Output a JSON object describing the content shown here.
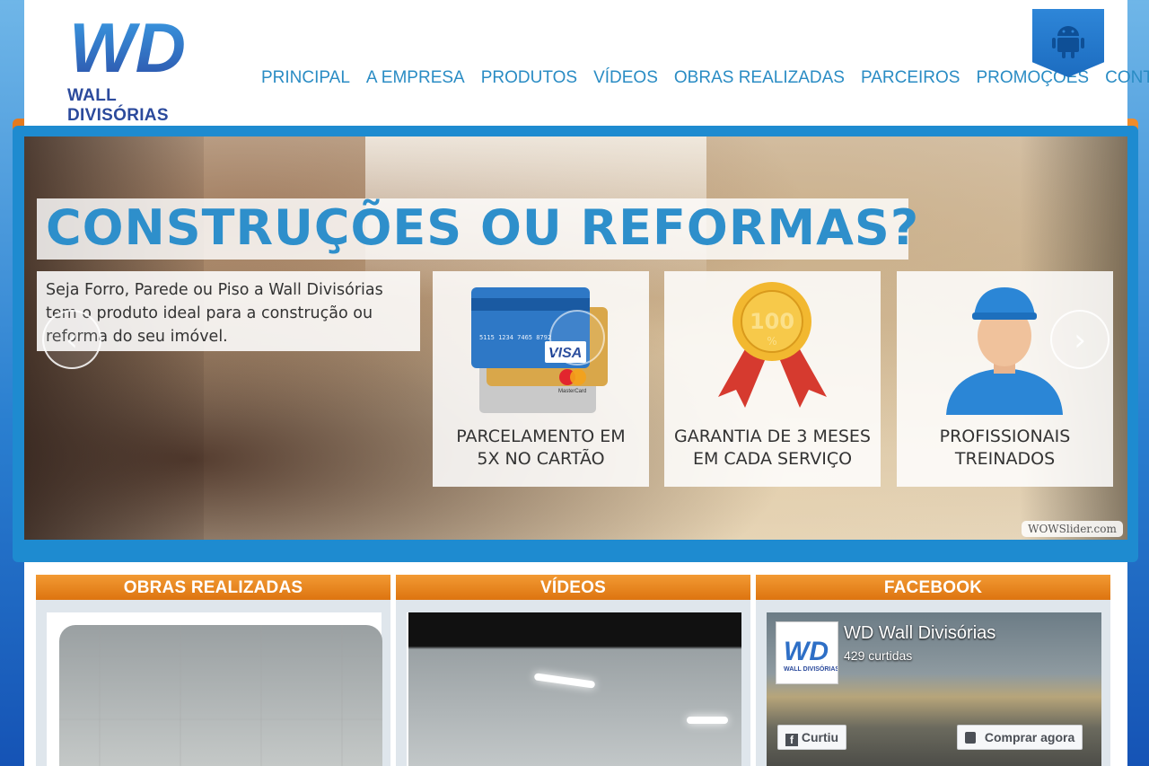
{
  "brand": {
    "logo_letters": "WD",
    "name": "WALL DIVISÓRIAS"
  },
  "nav": {
    "items": [
      {
        "label": "PRINCIPAL"
      },
      {
        "label": "A EMPRESA"
      },
      {
        "label": "PRODUTOS"
      },
      {
        "label": "VÍDEOS"
      },
      {
        "label": "OBRAS REALIZADAS"
      },
      {
        "label": "PARCEIROS"
      },
      {
        "label": "PROMOÇÕES"
      },
      {
        "label": "CONTATO"
      }
    ]
  },
  "slider": {
    "headline": "CONSTRUÇÕES OU REFORMAS?",
    "intro": "Seja Forro, Parede ou Piso a Wall Divisórias tem o produto ideal para a construção ou reforma do seu imóvel.",
    "features": [
      {
        "label": "PARCELAMENTO EM\n5X NO CARTÃO",
        "icon": "credit-cards-icon"
      },
      {
        "label": "GARANTIA DE 3 MESES\nEM CADA SERVIÇO",
        "icon": "guarantee-seal-icon",
        "seal_text": "100",
        "seal_sub": "%"
      },
      {
        "label": "PROFISSIONAIS\nTREINADOS",
        "icon": "professional-worker-icon"
      }
    ],
    "prev_arrow": "‹",
    "next_arrow": "›",
    "credit": "WOWSlider.com",
    "card_numbers": "5115 1234 7465 8792",
    "card_brands": [
      "VISA",
      "MasterCard"
    ]
  },
  "sections": {
    "obras": {
      "title": "OBRAS REALIZADAS"
    },
    "videos": {
      "title": "VÍDEOS"
    },
    "facebook": {
      "title": "FACEBOOK",
      "page_name": "WD Wall Divisórias",
      "likes": "429 curtidas",
      "like_button": "Curtiu",
      "shop_button": "Comprar agora"
    }
  },
  "colors": {
    "accent_blue": "#2e8fcb",
    "nav_blue": "#2a8cc4",
    "orange": "#e57a1e",
    "brand_navy": "#2b4a9c"
  }
}
